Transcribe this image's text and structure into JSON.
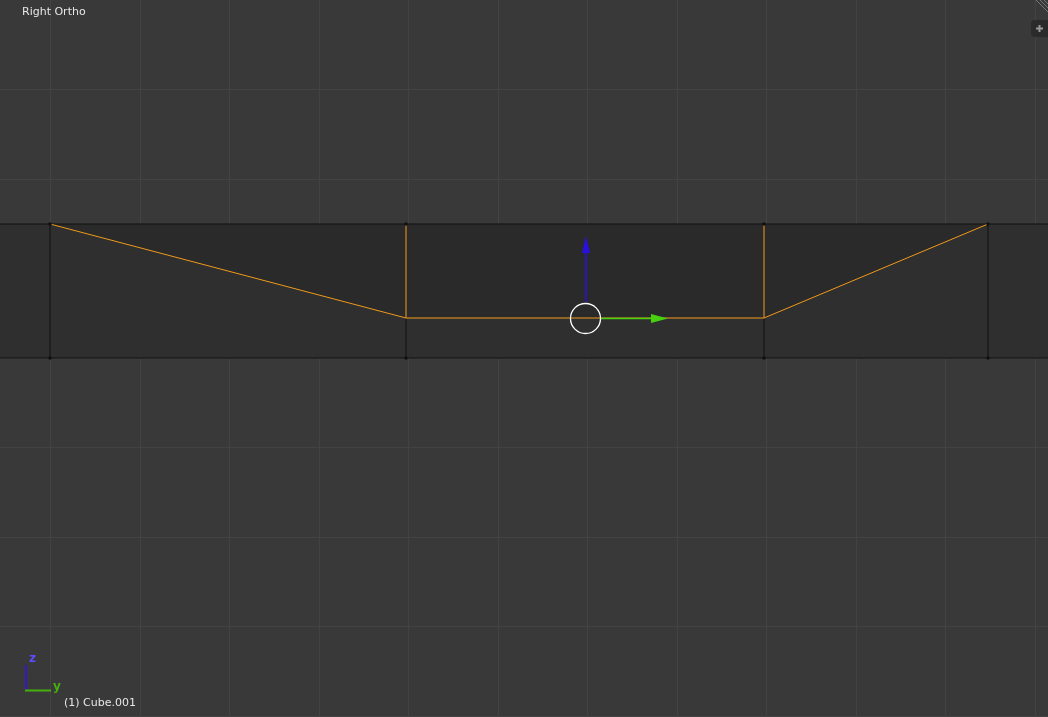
{
  "viewport": {
    "title": "Right Ortho",
    "object_label": "(1) Cube.001",
    "axis_labels": [
      {
        "label": "z",
        "color": "#5b4dff"
      },
      {
        "label": "y",
        "color": "#45b00c"
      }
    ]
  }
}
